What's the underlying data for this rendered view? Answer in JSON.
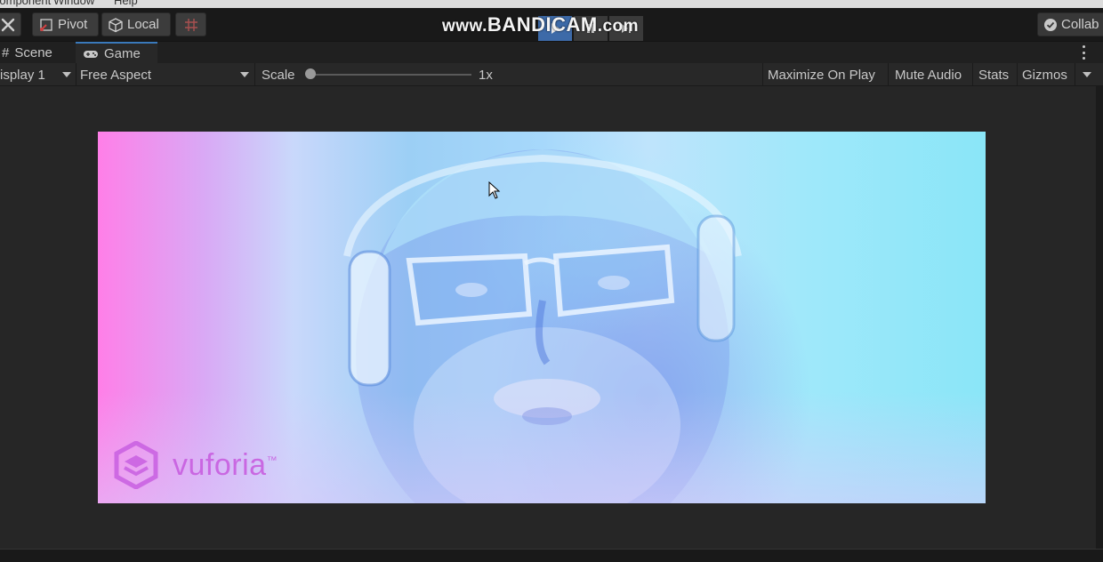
{
  "menu": {
    "items": [
      "Component",
      "Window",
      "Help"
    ]
  },
  "toolbar": {
    "pivot_label": "Pivot",
    "local_label": "Local",
    "collab_label": "Collab",
    "watermark_prefix": "www.",
    "watermark_brand": "BANDICAM",
    "watermark_suffix": ".com"
  },
  "tabs": [
    {
      "label": "Scene",
      "icon": "hash-icon"
    },
    {
      "label": "Game",
      "icon": "gamepad-icon"
    }
  ],
  "game_toolbar": {
    "display": "isplay 1",
    "aspect": "Free Aspect",
    "scale_label": "Scale",
    "scale_value": "1x",
    "maximize_on_play": "Maximize On Play",
    "mute_audio": "Mute Audio",
    "stats": "Stats",
    "gizmos": "Gizmos"
  },
  "game_view": {
    "logo_text": "vuforia",
    "logo_mark": "™"
  },
  "colors": {
    "accent": "#3a79bb",
    "play_active": "#3d6aa8",
    "vuforia": "#c85fe0"
  }
}
